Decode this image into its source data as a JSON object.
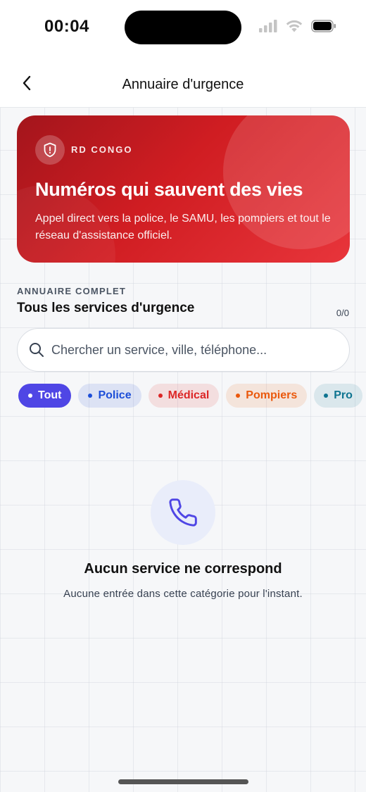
{
  "status_bar": {
    "time": "00:04"
  },
  "header": {
    "title": "Annuaire d'urgence"
  },
  "hero": {
    "country": "RD CONGO",
    "title": "Numéros qui sauvent des vies",
    "description": "Appel direct vers la police, le SAMU, les pompiers et tout le réseau d'assistance officiel."
  },
  "section": {
    "kicker": "ANNUAIRE COMPLET",
    "title": "Tous les services d'urgence",
    "count": "0/0"
  },
  "search": {
    "placeholder": "Chercher un service, ville, téléphone..."
  },
  "filters": [
    {
      "label": "Tout",
      "selected": true,
      "color": "#4f46e5"
    },
    {
      "label": "Police",
      "selected": false,
      "color": "#1d4ed8"
    },
    {
      "label": "Médical",
      "selected": false,
      "color": "#dc2626"
    },
    {
      "label": "Pompiers",
      "selected": false,
      "color": "#ea580c"
    },
    {
      "label": "Pro",
      "selected": false,
      "color": "#0e7490"
    }
  ],
  "empty_state": {
    "icon": "phone-icon",
    "title": "Aucun service ne correspond",
    "description": "Aucune entrée dans cette catégorie pour l'instant."
  },
  "colors": {
    "accent": "#4f46e5",
    "hero_red": "#d01d22"
  }
}
